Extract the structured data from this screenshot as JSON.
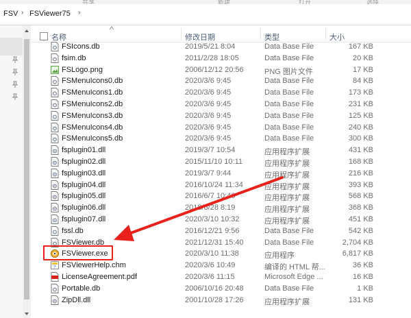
{
  "top_strip": {
    "items": [
      "共享",
      "新建",
      "打开",
      "选择"
    ]
  },
  "breadcrumb": [
    "FSV",
    "FSViewer75"
  ],
  "columns": {
    "name": "名称",
    "date": "修改日期",
    "type": "类型",
    "size": "大小"
  },
  "files": [
    {
      "name": "FSIcons.db",
      "date": "2019/5/21 8:04",
      "type": "Data Base File",
      "size": "167 KB",
      "icon": "db-file-icon"
    },
    {
      "name": "fsim.db",
      "date": "2011/2/28 18:05",
      "type": "Data Base File",
      "size": "20 KB",
      "icon": "db-file-icon"
    },
    {
      "name": "FSLogo.png",
      "date": "2006/12/12 20:56",
      "type": "PNG 图片文件",
      "size": "17 KB",
      "icon": "png-image-icon"
    },
    {
      "name": "FSMenuIcons0.db",
      "date": "2020/3/6 9:45",
      "type": "Data Base File",
      "size": "84 KB",
      "icon": "db-file-icon"
    },
    {
      "name": "FSMenuIcons1.db",
      "date": "2020/3/6 9:45",
      "type": "Data Base File",
      "size": "173 KB",
      "icon": "db-file-icon"
    },
    {
      "name": "FSMenuIcons2.db",
      "date": "2020/3/6 9:45",
      "type": "Data Base File",
      "size": "231 KB",
      "icon": "db-file-icon"
    },
    {
      "name": "FSMenuIcons3.db",
      "date": "2020/3/6 9:45",
      "type": "Data Base File",
      "size": "125 KB",
      "icon": "db-file-icon"
    },
    {
      "name": "FSMenuIcons4.db",
      "date": "2020/3/6 9:45",
      "type": "Data Base File",
      "size": "240 KB",
      "icon": "db-file-icon"
    },
    {
      "name": "FSMenuIcons5.db",
      "date": "2020/3/6 9:45",
      "type": "Data Base File",
      "size": "300 KB",
      "icon": "db-file-icon"
    },
    {
      "name": "fsplugin01.dll",
      "date": "2019/3/7 10:54",
      "type": "应用程序扩展",
      "size": "431 KB",
      "icon": "dll-file-icon"
    },
    {
      "name": "fsplugin02.dll",
      "date": "2015/11/10 10:11",
      "type": "应用程序扩展",
      "size": "168 KB",
      "icon": "dll-file-icon"
    },
    {
      "name": "fsplugin03.dll",
      "date": "2019/3/7 9:44",
      "type": "应用程序扩展",
      "size": "216 KB",
      "icon": "dll-file-icon"
    },
    {
      "name": "fsplugin04.dll",
      "date": "2016/10/24 11:34",
      "type": "应用程序扩展",
      "size": "393 KB",
      "icon": "dll-file-icon"
    },
    {
      "name": "fsplugin05.dll",
      "date": "2016/6/7 10:46",
      "type": "应用程序扩展",
      "size": "568 KB",
      "icon": "dll-file-icon"
    },
    {
      "name": "fsplugin06.dll",
      "date": "2018/6/28 8:19",
      "type": "应用程序扩展",
      "size": "368 KB",
      "icon": "dll-file-icon"
    },
    {
      "name": "fsplugin07.dll",
      "date": "2020/3/10 10:32",
      "type": "应用程序扩展",
      "size": "451 KB",
      "icon": "dll-file-icon"
    },
    {
      "name": "fssl.db",
      "date": "2016/12/21 9:56",
      "type": "Data Base File",
      "size": "542 KB",
      "icon": "db-file-icon"
    },
    {
      "name": "FSViewer.db",
      "date": "2021/12/31 15:40",
      "type": "Data Base File",
      "size": "2,704 KB",
      "icon": "db-file-icon"
    },
    {
      "name": "FSViewer.exe",
      "date": "2020/3/10 11:38",
      "type": "应用程序",
      "size": "6,817 KB",
      "icon": "fsviewer-app-icon"
    },
    {
      "name": "FSViewerHelp.chm",
      "date": "2020/3/6 10:49",
      "type": "编译的 HTML 帮...",
      "size": "36 KB",
      "icon": "chm-help-icon"
    },
    {
      "name": "LicenseAgreement.pdf",
      "date": "2020/3/6 11:15",
      "type": "Microsoft Edge ...",
      "size": "16 KB",
      "icon": "pdf-file-icon"
    },
    {
      "name": "Portable.db",
      "date": "2006/10/16 20:48",
      "type": "Data Base File",
      "size": "1 KB",
      "icon": "db-file-icon"
    },
    {
      "name": "ZipDll.dll",
      "date": "2001/10/28 17:26",
      "type": "应用程序扩展",
      "size": "131 KB",
      "icon": "dll-file-icon"
    }
  ],
  "colors": {
    "highlight": "#e8221b",
    "header_text": "#4c607a",
    "meta_text": "#6d6d6d"
  }
}
